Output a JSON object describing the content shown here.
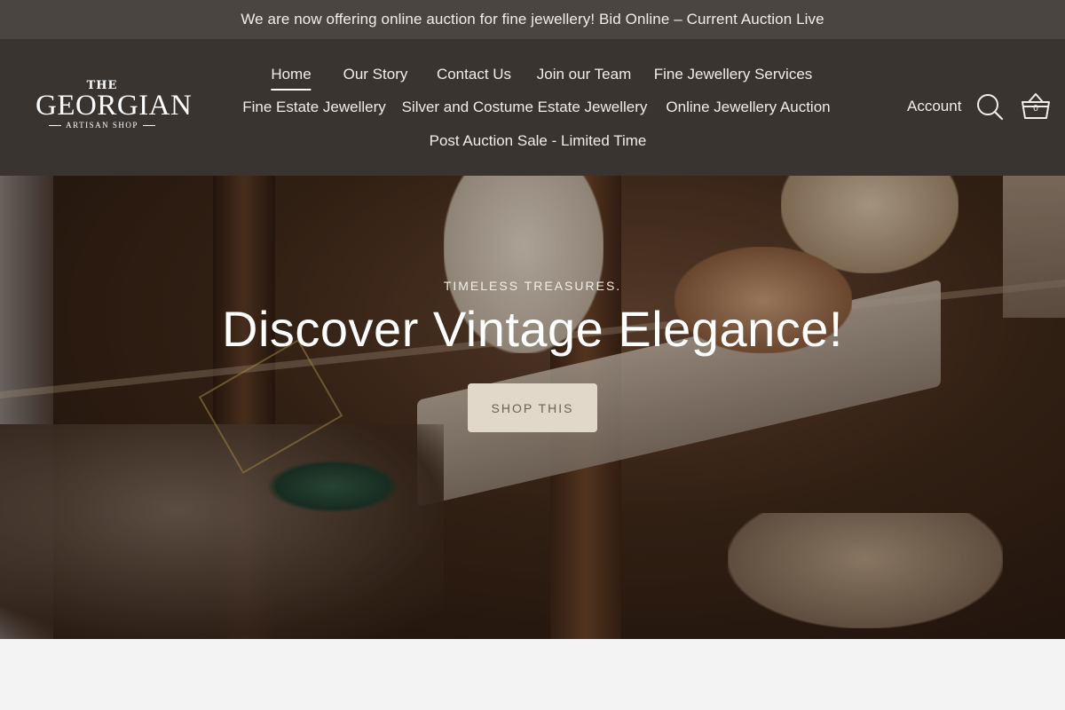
{
  "announcement": {
    "text": "We are now offering online auction for fine jewellery! Bid Online – Current Auction Live"
  },
  "logo": {
    "line1": "THE",
    "line2": "GEORGIAN",
    "line3": "ARTISAN SHOP"
  },
  "nav": {
    "row1": [
      "Home",
      "Our Story",
      "Contact Us",
      "Join our Team",
      "Fine Jewellery Services"
    ],
    "row2": [
      "Fine Estate Jewellery",
      "Silver and Costume Estate Jewellery",
      "Online Jewellery Auction"
    ],
    "row3": [
      "Post Auction Sale - Limited Time"
    ],
    "active": "Home"
  },
  "header_actions": {
    "account_label": "Account",
    "search_icon": "search-icon",
    "cart_icon": "basket-icon",
    "cart_count": "0"
  },
  "hero": {
    "eyebrow": "TIMELESS TREASURES.",
    "headline": "Discover Vintage Elegance!",
    "cta_label": "SHOP THIS"
  },
  "colors": {
    "announcement_bg": "#4b4541",
    "header_bg": "#393430",
    "cta_bg": "#e1d8c9",
    "page_bg": "#f3f3f3"
  }
}
